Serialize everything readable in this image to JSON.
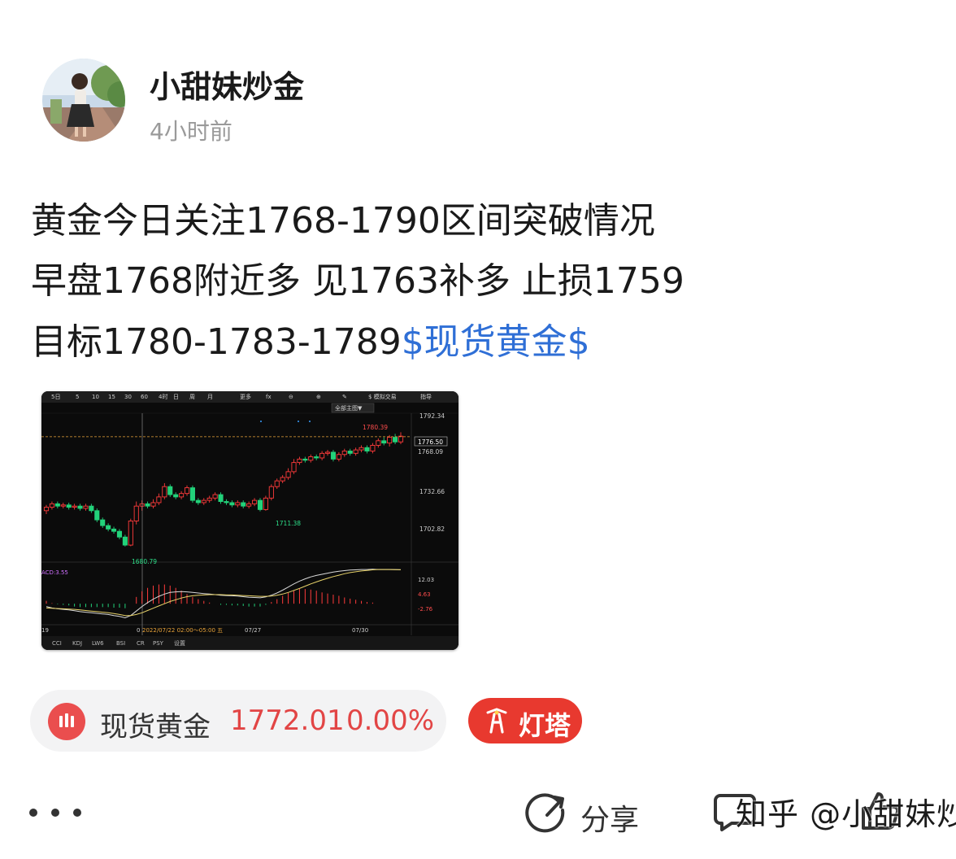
{
  "author": {
    "name": "小甜妹炒金",
    "time": "4小时前"
  },
  "post": {
    "line1": "黄金今日关注1768-1790区间突破情况",
    "line2": "早盘1768附近多 见1763补多 止损1759",
    "line3_text": "目标1780-1783-1789",
    "line3_topic": "$现货黄金$"
  },
  "chart": {
    "toolbar": [
      "5日",
      "5",
      "10",
      "15",
      "30",
      "60",
      "4时",
      "日",
      "周",
      "月",
      "更多",
      "fx",
      "⊖",
      "⊕",
      "✎",
      "$ 模拟交易",
      "指导"
    ],
    "main_selector": "全部主图▼",
    "price_levels": [
      "1792.34",
      "1776.50",
      "1768.09",
      "1732.66",
      "1702.82"
    ],
    "annotations": {
      "high": "1780.39",
      "low1": "1680.79",
      "low2": "1711.38"
    },
    "macd_label": "ACD:3.55",
    "macd_levels": [
      "12.03",
      "4.63",
      "-2.76"
    ],
    "date_labels": {
      "cursor": "2022/07/22 02:00～05:00 五",
      "d1": "07/27",
      "d2": "07/30",
      "left_edge": "19",
      "cursor_prefix": "0"
    },
    "indicator_tabs": [
      "CCI",
      "KDJ",
      "LW6",
      "BSI",
      "CR",
      "PSY",
      "设置"
    ],
    "colors": {
      "up": "#ff3b3b",
      "down": "#22d27a",
      "cursor_tag": "#e8a33a"
    }
  },
  "chart_data": {
    "type": "candlestick",
    "title": "",
    "ylim": [
      1670,
      1797
    ],
    "current_price": 1776.5,
    "reference_price": 1768.09,
    "high": 1780.39,
    "lows": [
      1680.79,
      1711.38
    ],
    "candles": [
      {
        "o": 1712,
        "c": 1715,
        "h": 1717,
        "l": 1709
      },
      {
        "o": 1715,
        "c": 1718,
        "h": 1720,
        "l": 1713
      },
      {
        "o": 1718,
        "c": 1716,
        "h": 1720,
        "l": 1714
      },
      {
        "o": 1716,
        "c": 1717,
        "h": 1719,
        "l": 1714
      },
      {
        "o": 1717,
        "c": 1715,
        "h": 1719,
        "l": 1713
      },
      {
        "o": 1715,
        "c": 1716,
        "h": 1718,
        "l": 1713
      },
      {
        "o": 1716,
        "c": 1714,
        "h": 1718,
        "l": 1712
      },
      {
        "o": 1714,
        "c": 1716,
        "h": 1718,
        "l": 1712
      },
      {
        "o": 1716,
        "c": 1712,
        "h": 1718,
        "l": 1710
      },
      {
        "o": 1712,
        "c": 1704,
        "h": 1714,
        "l": 1702
      },
      {
        "o": 1704,
        "c": 1699,
        "h": 1706,
        "l": 1697
      },
      {
        "o": 1699,
        "c": 1696,
        "h": 1701,
        "l": 1694
      },
      {
        "o": 1696,
        "c": 1694,
        "h": 1698,
        "l": 1692
      },
      {
        "o": 1694,
        "c": 1689,
        "h": 1696,
        "l": 1687
      },
      {
        "o": 1689,
        "c": 1682,
        "h": 1691,
        "l": 1680.79
      },
      {
        "o": 1682,
        "c": 1703,
        "h": 1705,
        "l": 1681
      },
      {
        "o": 1703,
        "c": 1716,
        "h": 1720,
        "l": 1700
      },
      {
        "o": 1716,
        "c": 1718,
        "h": 1721,
        "l": 1712
      },
      {
        "o": 1718,
        "c": 1716,
        "h": 1720,
        "l": 1714
      },
      {
        "o": 1716,
        "c": 1719,
        "h": 1722,
        "l": 1714
      },
      {
        "o": 1719,
        "c": 1724,
        "h": 1727,
        "l": 1717
      },
      {
        "o": 1724,
        "c": 1733,
        "h": 1736,
        "l": 1722
      },
      {
        "o": 1733,
        "c": 1726,
        "h": 1735,
        "l": 1724
      },
      {
        "o": 1726,
        "c": 1724,
        "h": 1728,
        "l": 1722
      },
      {
        "o": 1724,
        "c": 1727,
        "h": 1729,
        "l": 1722
      },
      {
        "o": 1727,
        "c": 1732,
        "h": 1734,
        "l": 1725
      },
      {
        "o": 1732,
        "c": 1721,
        "h": 1734,
        "l": 1719
      },
      {
        "o": 1721,
        "c": 1719,
        "h": 1723,
        "l": 1717
      },
      {
        "o": 1719,
        "c": 1721,
        "h": 1723,
        "l": 1717
      },
      {
        "o": 1721,
        "c": 1723,
        "h": 1725,
        "l": 1719
      },
      {
        "o": 1723,
        "c": 1726,
        "h": 1728,
        "l": 1721
      },
      {
        "o": 1726,
        "c": 1720,
        "h": 1728,
        "l": 1718
      },
      {
        "o": 1720,
        "c": 1719,
        "h": 1722,
        "l": 1717
      },
      {
        "o": 1719,
        "c": 1717,
        "h": 1721,
        "l": 1715
      },
      {
        "o": 1717,
        "c": 1719,
        "h": 1721,
        "l": 1715
      },
      {
        "o": 1719,
        "c": 1716,
        "h": 1721,
        "l": 1714
      },
      {
        "o": 1716,
        "c": 1718,
        "h": 1720,
        "l": 1714
      },
      {
        "o": 1718,
        "c": 1721,
        "h": 1723,
        "l": 1716
      },
      {
        "o": 1721,
        "c": 1713,
        "h": 1723,
        "l": 1711.38
      },
      {
        "o": 1713,
        "c": 1723,
        "h": 1725,
        "l": 1712
      },
      {
        "o": 1723,
        "c": 1733,
        "h": 1735,
        "l": 1721
      },
      {
        "o": 1733,
        "c": 1738,
        "h": 1740,
        "l": 1731
      },
      {
        "o": 1738,
        "c": 1741,
        "h": 1743,
        "l": 1736
      },
      {
        "o": 1741,
        "c": 1746,
        "h": 1749,
        "l": 1739
      },
      {
        "o": 1746,
        "c": 1754,
        "h": 1757,
        "l": 1744
      },
      {
        "o": 1754,
        "c": 1757,
        "h": 1759,
        "l": 1752
      },
      {
        "o": 1757,
        "c": 1756,
        "h": 1759,
        "l": 1754
      },
      {
        "o": 1756,
        "c": 1759,
        "h": 1761,
        "l": 1754
      },
      {
        "o": 1759,
        "c": 1758,
        "h": 1761,
        "l": 1756
      },
      {
        "o": 1758,
        "c": 1762,
        "h": 1764,
        "l": 1756
      },
      {
        "o": 1762,
        "c": 1763,
        "h": 1765,
        "l": 1760
      },
      {
        "o": 1763,
        "c": 1757,
        "h": 1765,
        "l": 1755
      },
      {
        "o": 1757,
        "c": 1761,
        "h": 1763,
        "l": 1755
      },
      {
        "o": 1761,
        "c": 1764,
        "h": 1766,
        "l": 1759
      },
      {
        "o": 1764,
        "c": 1762,
        "h": 1766,
        "l": 1760
      },
      {
        "o": 1762,
        "c": 1765,
        "h": 1767,
        "l": 1760
      },
      {
        "o": 1765,
        "c": 1767,
        "h": 1769,
        "l": 1763
      },
      {
        "o": 1767,
        "c": 1764,
        "h": 1769,
        "l": 1762
      },
      {
        "o": 1764,
        "c": 1769,
        "h": 1771,
        "l": 1762
      },
      {
        "o": 1769,
        "c": 1773,
        "h": 1775,
        "l": 1767
      },
      {
        "o": 1773,
        "c": 1771,
        "h": 1776,
        "l": 1769
      },
      {
        "o": 1771,
        "c": 1776,
        "h": 1778,
        "l": 1768
      },
      {
        "o": 1776,
        "c": 1772,
        "h": 1779,
        "l": 1770
      },
      {
        "o": 1772,
        "c": 1777,
        "h": 1780.39,
        "l": 1770
      }
    ],
    "macd": {
      "dif": [
        -1,
        -1.5,
        -1.8,
        -2,
        -2.2,
        -2.5,
        -2.8,
        -3,
        -3.2,
        -3.4,
        -3.6,
        -3.8,
        -4.2,
        -4.5,
        -5,
        -4.2,
        -2.6,
        -1,
        0.4,
        1.6,
        2.6,
        3.4,
        4,
        4.2,
        4.3,
        4.2,
        4,
        3.8,
        3.6,
        3.4,
        3.2,
        3,
        2.9,
        2.8,
        2.7,
        2.5,
        2.3,
        2.2,
        2.1,
        2.4,
        3,
        3.8,
        4.8,
        5.9,
        7,
        8,
        8.8,
        9.5,
        10,
        10.4,
        10.8,
        11.2,
        11.5,
        11.7,
        11.9,
        12,
        12.1,
        12.1,
        12.2,
        12.1,
        12.1,
        12.1,
        12.05,
        12.03
      ],
      "dea": [
        -1.5,
        -1.6,
        -1.7,
        -1.8,
        -1.9,
        -2,
        -2.2,
        -2.4,
        -2.6,
        -2.8,
        -3,
        -3.2,
        -3.5,
        -3.8,
        -4.2,
        -4.2,
        -3.8,
        -3.2,
        -2.4,
        -1.6,
        -0.8,
        0,
        0.8,
        1.4,
        2,
        2.5,
        2.8,
        3,
        3.1,
        3.2,
        3.2,
        3.2,
        3.1,
        3.1,
        3,
        2.9,
        2.8,
        2.7,
        2.6,
        2.6,
        2.7,
        3,
        3.4,
        4,
        4.7,
        5.4,
        6.2,
        7,
        7.7,
        8.4,
        9,
        9.6,
        10.1,
        10.6,
        11,
        11.3,
        11.6,
        11.8,
        12,
        12.1,
        12.1,
        12.1,
        12.05,
        12.03
      ]
    }
  },
  "quote": {
    "name": "现货黄金",
    "price": "1772.01",
    "change": "0.00%"
  },
  "beacon": {
    "label": "灯塔"
  },
  "actions": {
    "share_label": "分享"
  },
  "watermark": "知乎 @小甜妹炒金",
  "colors": {
    "link": "#2f6fd6",
    "price_red": "#e24545",
    "beacon_bg": "#e8392f",
    "pill_bg": "#f3f3f4"
  }
}
